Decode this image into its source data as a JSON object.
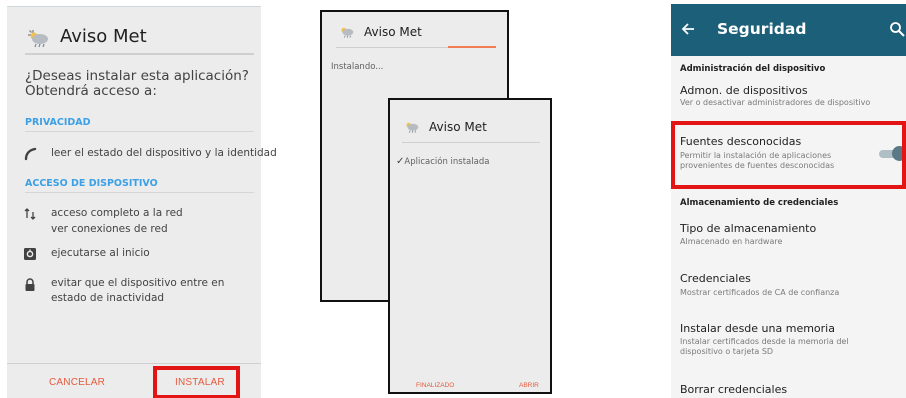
{
  "install_dialog": {
    "app_name": "Aviso Met",
    "question": "¿Deseas instalar esta aplicación? Obtendrá acceso a:",
    "sections": [
      {
        "heading": "PRIVACIDAD",
        "permissions": [
          {
            "icon": "phone-icon",
            "lines": [
              "leer el estado del dispositivo y la identidad"
            ]
          }
        ]
      },
      {
        "heading": "ACCESO DE DISPOSITIVO",
        "permissions": [
          {
            "icon": "network-arrows-icon",
            "lines": [
              "acceso completo a la red",
              "ver conexiones de red"
            ]
          },
          {
            "icon": "startup-icon",
            "lines": [
              "ejecutarse al inicio"
            ]
          },
          {
            "icon": "lock-icon",
            "lines": [
              "evitar que el dispositivo entre en estado de inactividad"
            ]
          }
        ]
      }
    ],
    "cancel_label": "CANCELAR",
    "install_label": "INSTALAR",
    "highlight_color": "#e31414"
  },
  "installing_dialog": {
    "app_name": "Aviso Met",
    "status": "Instalando...",
    "progress": 0.3,
    "progress_color": "#f27d54"
  },
  "installed_dialog": {
    "app_name": "Aviso Met",
    "status": "Aplicación instalada",
    "done_label": "FINALIZADO",
    "open_label": "ABRIR"
  },
  "security_settings": {
    "title": "Seguridad",
    "appbar_color": "#1c5f79",
    "section_device_admin": "Administración del dispositivo",
    "device_admin": {
      "title": "Admon. de dispositivos",
      "subtitle": "Ver o desactivar administradores de dispositivo"
    },
    "unknown_sources": {
      "title": "Fuentes desconocidas",
      "subtitle": "Permitir la instalación de aplicaciones provenientes de fuentes desconocidas",
      "enabled": true
    },
    "section_credentials": "Almacenamiento de credenciales",
    "storage_type": {
      "title": "Tipo de almacenamiento",
      "subtitle": "Almacenado en hardware"
    },
    "credentials": {
      "title": "Credenciales",
      "subtitle": "Mostrar certificados de CA de confianza"
    },
    "install_from_storage": {
      "title": "Instalar desde una memoria",
      "subtitle": "Instalar certificados desde la memoria del dispositivo o tarjeta SD"
    },
    "clear_credentials": {
      "title": "Borrar credenciales"
    }
  }
}
